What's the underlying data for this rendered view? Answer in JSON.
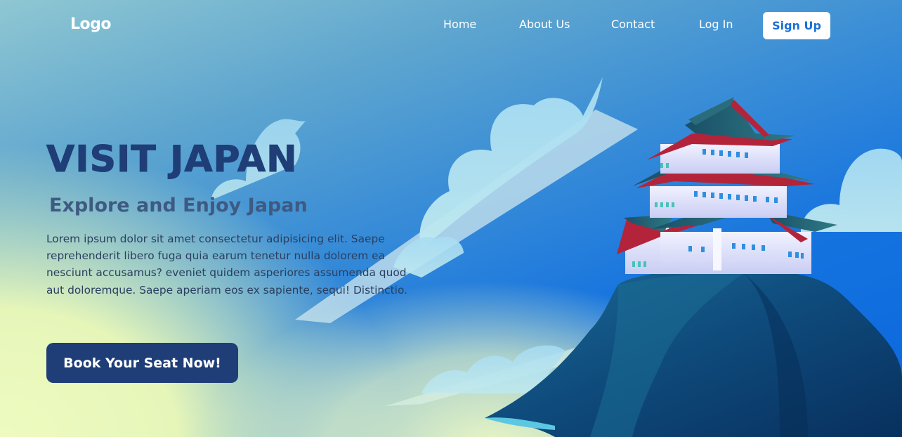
{
  "header": {
    "logo": "Logo",
    "nav": [
      {
        "label": "Home"
      },
      {
        "label": "About Us"
      },
      {
        "label": "Contact"
      },
      {
        "label": "Log In"
      }
    ],
    "signup_label": "Sign Up"
  },
  "hero": {
    "title": "VISIT JAPAN",
    "subtitle": "Explore and Enjoy Japan",
    "body": "Lorem ipsum dolor sit amet consectetur adipisicing elit. Saepe reprehenderit libero fuga quia earum tenetur nulla dolorem ea nesciunt accusamus? eveniet quidem asperiores assumenda quod aut doloremque. Saepe aperiam eos ex sapiente, sequi! Distinctio.",
    "cta_label": "Book Your Seat Now!"
  },
  "illustration": {
    "subject": "japanese-castle-on-mountain",
    "colors": {
      "mountain": "#0f4f7e",
      "roof": "#1f5a6e",
      "roof_trim": "#b3243a",
      "wall": "#e9ecfb",
      "window": "#2e8fe0",
      "cloud": "#a9dcf2"
    }
  }
}
